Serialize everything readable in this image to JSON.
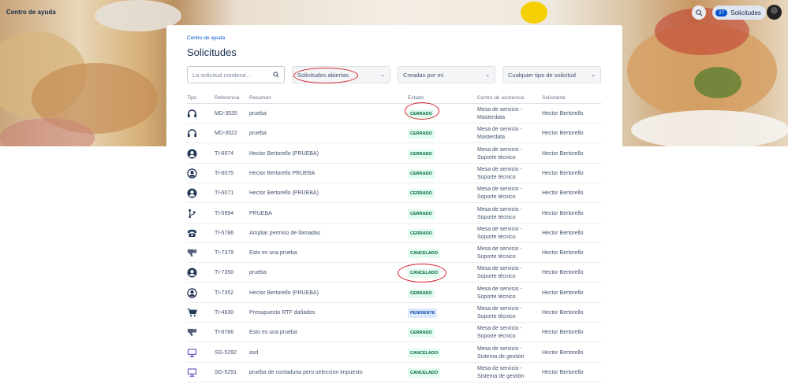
{
  "header": {
    "brand": "Centro de ayuda",
    "requests_count": "27",
    "requests_label": "Solicitudes"
  },
  "page": {
    "breadcrumb": "Centro de ayuda",
    "title": "Solicitudes"
  },
  "filters": {
    "search_placeholder": "La solicitud contiene...",
    "status": "Solicitudes abiertas",
    "creator": "Creadas por mi",
    "type": "Cualquier tipo de solicitud"
  },
  "columns": {
    "tipo": "Tipo",
    "referencia": "Referencia",
    "resumen": "Resumen",
    "estado": "Estado",
    "centro": "Centro de asistencia",
    "solicitante": "Solicitante"
  },
  "colors": {
    "closed_bg": "#e3fcef",
    "closed_fg": "#006644",
    "pending_bg": "#deebff",
    "pending_fg": "#0747a6",
    "annotation": "#d6202a"
  },
  "rows": [
    {
      "icon": "headset-icon",
      "ref": "MD-3535",
      "summary": "prueba",
      "status": "CERRADO",
      "kind": "closed",
      "center1": "Mesa de servicio -",
      "center2": "Masterdata",
      "requester": "Hector Bertorello"
    },
    {
      "icon": "headset-icon",
      "ref": "MD-3522",
      "summary": "prueba",
      "status": "CERRADO",
      "kind": "closed",
      "center1": "Mesa de servicio -",
      "center2": "Masterdata",
      "requester": "Hector Bertorello"
    },
    {
      "icon": "user-icon",
      "ref": "TI-6074",
      "summary": "Hector Bertorello (PRUEBA)",
      "status": "CERRADO",
      "kind": "closed",
      "center1": "Mesa de servicio -",
      "center2": "Soporte técnico",
      "requester": "Hector Bertorello"
    },
    {
      "icon": "user-circle-icon",
      "ref": "TI-6075",
      "summary": "Hector Bertorello PRUEBA",
      "status": "CERRADO",
      "kind": "closed",
      "center1": "Mesa de servicio -",
      "center2": "Soporte técnico",
      "requester": "Hector Bertorello"
    },
    {
      "icon": "user-icon",
      "ref": "TI-6071",
      "summary": "Hector Bertorello (PRUEBA)",
      "status": "CERRADO",
      "kind": "closed",
      "center1": "Mesa de servicio -",
      "center2": "Soporte técnico",
      "requester": "Hector Bertorello"
    },
    {
      "icon": "branch-icon",
      "ref": "TI-5994",
      "summary": "PRUEBA",
      "status": "CERRADO",
      "kind": "closed",
      "center1": "Mesa de servicio -",
      "center2": "Soporte técnico",
      "requester": "Hector Bertorello"
    },
    {
      "icon": "phone-icon",
      "ref": "TI-5786",
      "summary": "Ampliar permiso de llamadas",
      "status": "CERRADO",
      "kind": "closed",
      "center1": "Mesa de servicio -",
      "center2": "Soporte técnico",
      "requester": "Hector Bertorello"
    },
    {
      "icon": "thumbs-down-icon",
      "ref": "TI-7379",
      "summary": "Esto es una prueba",
      "status": "CANCELADO",
      "kind": "closed",
      "center1": "Mesa de servicio -",
      "center2": "Soporte técnico",
      "requester": "Hector Bertorello"
    },
    {
      "icon": "user-icon",
      "ref": "TI-7350",
      "summary": "prueba",
      "status": "CANCELADO",
      "kind": "closed",
      "center1": "Mesa de servicio -",
      "center2": "Soporte técnico",
      "requester": "Hector Bertorello"
    },
    {
      "icon": "user-circle-icon",
      "ref": "TI-7352",
      "summary": "Hector Bertorello (PRUEBA)",
      "status": "CERRADO",
      "kind": "closed",
      "center1": "Mesa de servicio -",
      "center2": "Soporte técnico",
      "requester": "Hector Bertorello"
    },
    {
      "icon": "cart-icon",
      "ref": "TI-4630",
      "summary": "Presupuesto RTF dañados",
      "status": "PENDIENTE",
      "kind": "pending",
      "center1": "Mesa de servicio -",
      "center2": "Soporte técnico",
      "requester": "Hector Bertorello"
    },
    {
      "icon": "thumbs-down-icon",
      "ref": "TI-6786",
      "summary": "Esto es una prueba",
      "status": "CERRADO",
      "kind": "closed",
      "center1": "Mesa de servicio -",
      "center2": "Soporte técnico",
      "requester": "Hector Bertorello"
    },
    {
      "icon": "monitor-icon",
      "ref": "SG-5292",
      "summary": "asd",
      "status": "CANCELADO",
      "kind": "closed",
      "center1": "Mesa de servicio -",
      "center2": "Sistema de gestión",
      "requester": "Hector Bertorello"
    },
    {
      "icon": "monitor-icon",
      "ref": "SG-5291",
      "summary": "prueba de contaduria pero seleccion impuesto",
      "status": "CANCELADO",
      "kind": "closed",
      "center1": "Mesa de servicio -",
      "center2": "Sistema de gestión",
      "requester": "Hector Bertorello"
    }
  ]
}
